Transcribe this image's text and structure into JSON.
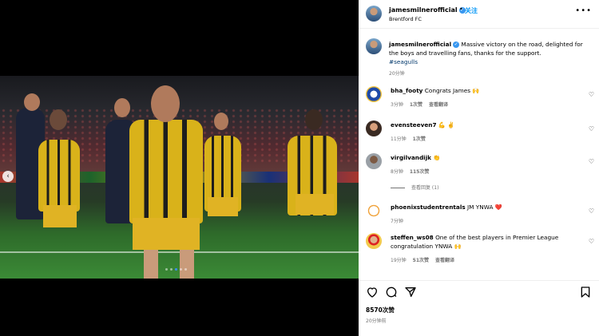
{
  "post": {
    "username": "jamesmilnerofficial",
    "follow_label": "关注",
    "location": "Brentford FC",
    "caption_user": "jamesmilnerofficial",
    "caption_text": "Massive victory on the road, delighted for the boys and travelling fans, thanks for the support.",
    "hashtag": "#seagulls",
    "caption_time": "20分钟",
    "likes": "8570次赞",
    "time": "20分钟前"
  },
  "carousel": {
    "dot_count": 5,
    "active_index": 2
  },
  "comments": [
    {
      "user": "bha_footy",
      "text": "Congrats James 🙌",
      "time": "3分钟",
      "likes": "1次赞",
      "action": "查看翻译"
    },
    {
      "user": "evensteeven7",
      "text": "💪 ✌️",
      "time": "11分钟",
      "likes": "1次赞",
      "action": ""
    },
    {
      "user": "virgilvandijk",
      "text": "👏",
      "time": "8分钟",
      "likes": "115次赞",
      "action": "",
      "replies": "查看回复 (1)"
    },
    {
      "user": "phoenixstudentrentals",
      "text": "JM YNWA ❤️",
      "time": "7分钟",
      "likes": "",
      "action": ""
    },
    {
      "user": "steffen_ws08",
      "text": "One of the best players in Premier League congratulation YNWA 🙌",
      "time": "19分钟",
      "likes": "51次赞",
      "action": "查看翻译"
    }
  ],
  "icons": {
    "verified": "verified-badge-icon",
    "more": "more-options-icon",
    "heart": "heart-icon",
    "comment": "comment-icon",
    "share": "share-icon",
    "save": "bookmark-icon",
    "prev": "chevron-left-icon"
  },
  "colors": {
    "accent": "#0095f6",
    "verified": "#3897f0",
    "hashtag": "#00376b",
    "muted": "#737373"
  }
}
